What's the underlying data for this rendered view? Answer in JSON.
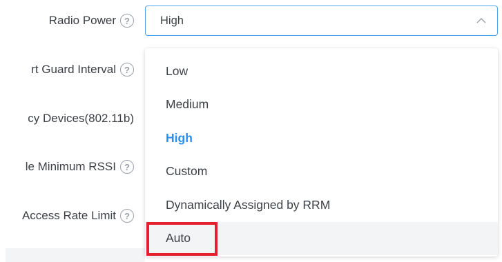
{
  "form": {
    "labels": [
      {
        "text": "Radio Power",
        "has_help": true
      },
      {
        "text": "rt Guard Interval",
        "has_help": true
      },
      {
        "text": "cy Devices(802.11b)",
        "has_help": false
      },
      {
        "text": "le Minimum RSSI",
        "has_help": true
      },
      {
        "text": "Access Rate Limit",
        "has_help": true
      }
    ],
    "help_glyph": "?"
  },
  "select": {
    "value": "High",
    "icon": "chevron-up-icon"
  },
  "dropdown": {
    "options": [
      {
        "label": "Low",
        "state": "normal"
      },
      {
        "label": "Medium",
        "state": "normal"
      },
      {
        "label": "High",
        "state": "selected"
      },
      {
        "label": "Custom",
        "state": "normal"
      },
      {
        "label": "Dynamically Assigned by RRM",
        "state": "normal"
      },
      {
        "label": "Auto",
        "state": "hover"
      }
    ],
    "highlight_color": "#e5202e",
    "selected_color": "#2b8ff0"
  }
}
